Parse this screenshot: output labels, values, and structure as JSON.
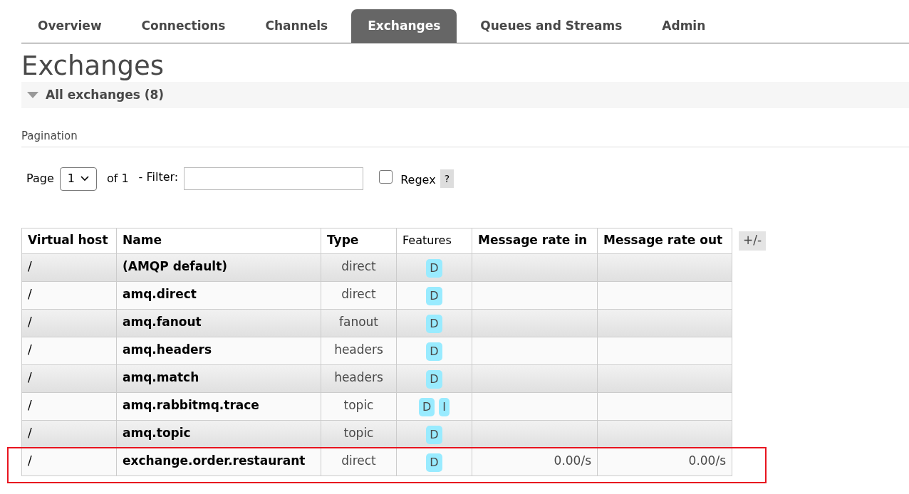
{
  "tabs": [
    {
      "label": "Overview",
      "selected": false
    },
    {
      "label": "Connections",
      "selected": false
    },
    {
      "label": "Channels",
      "selected": false
    },
    {
      "label": "Exchanges",
      "selected": true
    },
    {
      "label": "Queues and Streams",
      "selected": false
    },
    {
      "label": "Admin",
      "selected": false
    }
  ],
  "page_title": "Exchanges",
  "section": {
    "title": "All exchanges (8)",
    "expanded": true
  },
  "pagination": {
    "heading": "Pagination",
    "page_label": "Page",
    "page_value": "1",
    "of_label": "of 1",
    "filter_label": "- Filter:",
    "regex_label": "Regex",
    "regex_checked": false,
    "help": "?"
  },
  "table": {
    "columns": [
      "Virtual host",
      "Name",
      "Type",
      "Features",
      "Message rate in",
      "Message rate out"
    ],
    "toggle_columns": "+/-",
    "rows": [
      {
        "vhost": "/",
        "name": "(AMQP default)",
        "type": "direct",
        "features": [
          "D"
        ],
        "rate_in": "",
        "rate_out": "",
        "highlighted": false
      },
      {
        "vhost": "/",
        "name": "amq.direct",
        "type": "direct",
        "features": [
          "D"
        ],
        "rate_in": "",
        "rate_out": "",
        "highlighted": false
      },
      {
        "vhost": "/",
        "name": "amq.fanout",
        "type": "fanout",
        "features": [
          "D"
        ],
        "rate_in": "",
        "rate_out": "",
        "highlighted": false
      },
      {
        "vhost": "/",
        "name": "amq.headers",
        "type": "headers",
        "features": [
          "D"
        ],
        "rate_in": "",
        "rate_out": "",
        "highlighted": false
      },
      {
        "vhost": "/",
        "name": "amq.match",
        "type": "headers",
        "features": [
          "D"
        ],
        "rate_in": "",
        "rate_out": "",
        "highlighted": false
      },
      {
        "vhost": "/",
        "name": "amq.rabbitmq.trace",
        "type": "topic",
        "features": [
          "D",
          "I"
        ],
        "rate_in": "",
        "rate_out": "",
        "highlighted": false
      },
      {
        "vhost": "/",
        "name": "amq.topic",
        "type": "topic",
        "features": [
          "D"
        ],
        "rate_in": "",
        "rate_out": "",
        "highlighted": false
      },
      {
        "vhost": "/",
        "name": "exchange.order.restaurant",
        "type": "direct",
        "features": [
          "D"
        ],
        "rate_in": "0.00/s",
        "rate_out": "0.00/s",
        "highlighted": true
      }
    ]
  }
}
